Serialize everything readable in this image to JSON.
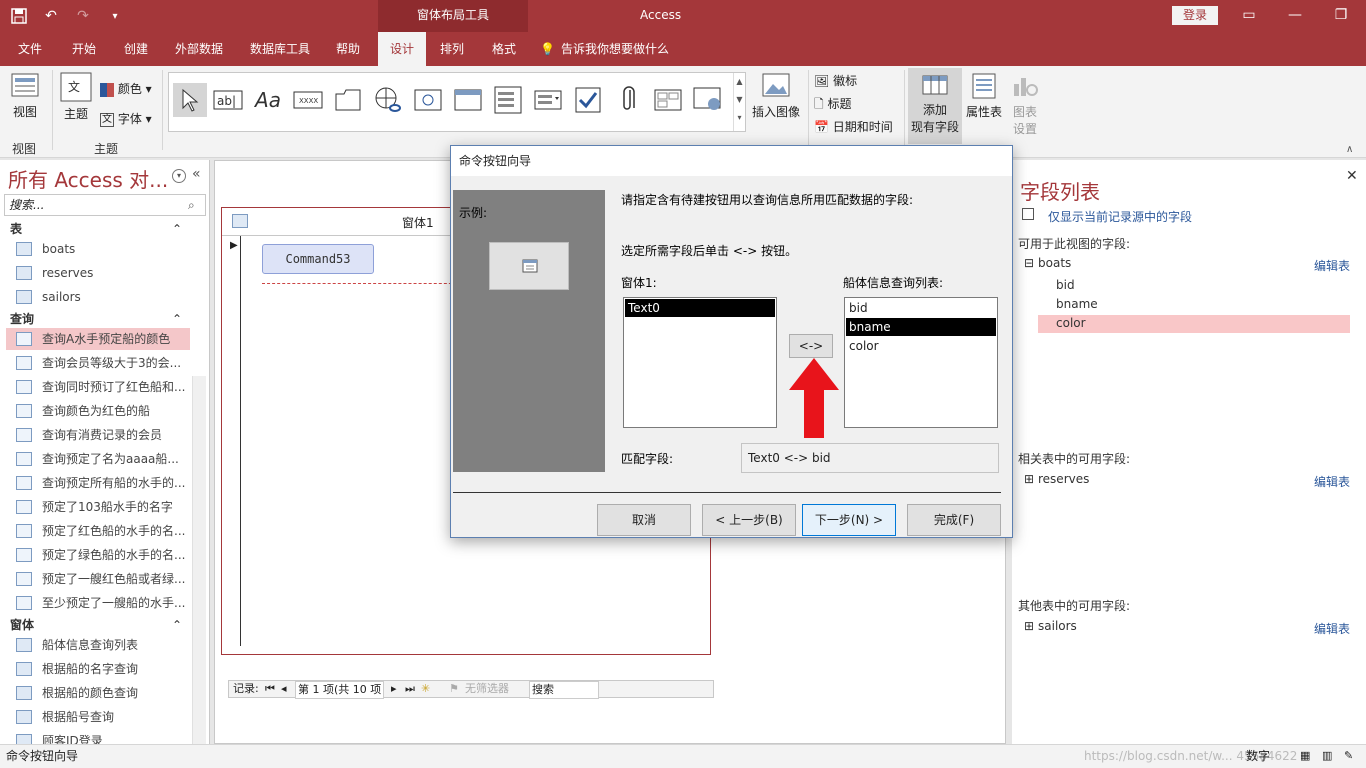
{
  "titlebar": {
    "context_tools": "窗体布局工具",
    "app_title": "Access",
    "login": "登录"
  },
  "tabs": [
    "文件",
    "开始",
    "创建",
    "外部数据",
    "数据库工具",
    "帮助",
    "设计",
    "排列",
    "格式"
  ],
  "tellme": "告诉我你想要做什么",
  "ribbon": {
    "view_btn": "视图",
    "view_group": "视图",
    "theme_btn": "主题",
    "colors_btn": "颜色",
    "fonts_btn": "字体",
    "theme_group": "主题",
    "insert_image": "插入图像",
    "logo": "徽标",
    "title": "标题",
    "datetime": "日期和时间",
    "add_fields_line1": "添加",
    "add_fields_line2": "现有字段",
    "property_sheet": "属性表",
    "chart_settings_line1": "图表",
    "chart_settings_line2": "设置"
  },
  "nav": {
    "title": "所有 Access 对...",
    "search_placeholder": "搜索...",
    "sections": {
      "tables": "表",
      "queries": "查询",
      "forms": "窗体"
    },
    "tables": [
      "boats",
      "reserves",
      "sailors"
    ],
    "queries": [
      "查询A水手预定船的颜色",
      "查询会员等级大于3的会...",
      "查询同时预订了红色船和...",
      "查询颜色为红色的船",
      "查询有消费记录的会员",
      "查询预定了名为aaaa船...",
      "查询预定所有船的水手的...",
      "预定了103船水手的名字",
      "预定了红色船的水手的名...",
      "预定了绿色船的水手的名...",
      "预定了一艘红色船或者绿...",
      "至少预定了一艘船的水手..."
    ],
    "forms": [
      "船体信息查询列表",
      "根据船的名字查询",
      "根据船的颜色查询",
      "根据船号查询",
      "顾客ID登录"
    ]
  },
  "document": {
    "form_title": "窗体1",
    "command_button": "Command53",
    "record_label": "记录:",
    "record_pos": "第 1 项(共 10 项",
    "no_filter": "无筛选器",
    "search": "搜索"
  },
  "fieldlist": {
    "title": "字段列表",
    "only_current": "仅显示当前记录源中的字段",
    "available_in_view": "可用于此视图的字段:",
    "table_boats": "boats",
    "edit_table": "编辑表",
    "fields": [
      "bid",
      "bname",
      "color"
    ],
    "related_label": "相关表中的可用字段:",
    "related_table": "reserves",
    "other_label": "其他表中的可用字段:",
    "other_table": "sailors"
  },
  "dialog": {
    "title": "命令按钮向导",
    "sample_label": "示例:",
    "instruction": "请指定含有待建按钮用以查询信息所用匹配数据的字段:",
    "sub_instruction": "选定所需字段后单击 <-> 按钮。",
    "left_list_label": "窗体1:",
    "left_list": [
      "Text0"
    ],
    "right_list_label": "船体信息查询列表:",
    "right_list": [
      "bid",
      "bname",
      "color"
    ],
    "swap_button": "<->",
    "match_label": "匹配字段:",
    "match_value": "Text0 <-> bid",
    "cancel": "取消",
    "back": "< 上一步(B)",
    "next": "下一步(N) >",
    "finish": "完成(F)"
  },
  "statusbar": {
    "left": "命令按钮向导",
    "right": "数字",
    "watermark": "https://blog.csdn.net/w... 45584622"
  },
  "colors": {
    "accent": "#a4373a",
    "arrow": "#e8141b"
  }
}
